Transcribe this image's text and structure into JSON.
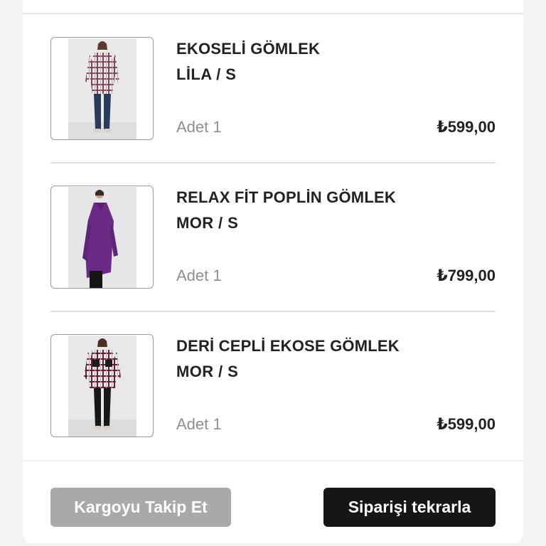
{
  "order": {
    "items": [
      {
        "name": "EKOSELİ GÖMLEK",
        "variant": "LİLA / S",
        "quantity": "Adet 1",
        "price": "₺599,00",
        "image_alt": "Checked shirt, lilac"
      },
      {
        "name": "RELAX FİT POPLİN GÖMLEK",
        "variant": "MOR / S",
        "quantity": "Adet 1",
        "price": "₺799,00",
        "image_alt": "Purple poplin shirt"
      },
      {
        "name": "DERİ CEPLİ EKOSE GÖMLEK",
        "variant": "MOR / S",
        "quantity": "Adet 1",
        "price": "₺599,00",
        "image_alt": "Checked shirt with leather pocket"
      }
    ]
  },
  "actions": {
    "track_label": "Kargoyu Takip Et",
    "repeat_label": "Siparişi tekrarla"
  },
  "colors": {
    "primary_button": "#161616",
    "disabled_button": "#a9a9a9",
    "text": "#222222",
    "muted_text": "#8e8e8e"
  }
}
